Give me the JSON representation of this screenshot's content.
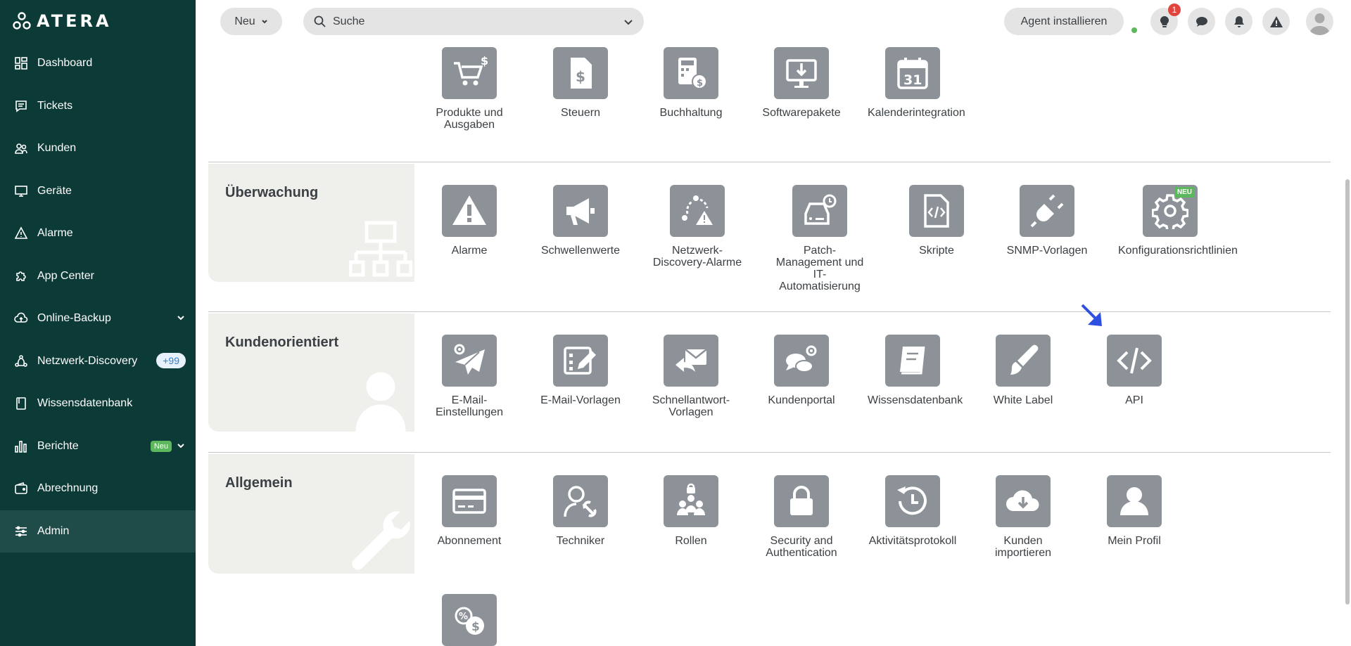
{
  "sidebar": {
    "logo": "ATERA",
    "items": [
      {
        "label": "Dashboard",
        "icon": "dashboard-icon"
      },
      {
        "label": "Tickets",
        "icon": "tickets-icon"
      },
      {
        "label": "Kunden",
        "icon": "customers-icon"
      },
      {
        "label": "Geräte",
        "icon": "devices-icon"
      },
      {
        "label": "Alarme",
        "icon": "alert-icon"
      },
      {
        "label": "App Center",
        "icon": "puzzle-icon"
      },
      {
        "label": "Online-Backup",
        "icon": "cloud-icon"
      },
      {
        "label": "Netzwerk-Discovery",
        "icon": "network-icon",
        "badge": "+99"
      },
      {
        "label": "Wissensdatenbank",
        "icon": "book-icon"
      },
      {
        "label": "Berichte",
        "icon": "chart-icon",
        "tag": "Neu"
      },
      {
        "label": "Abrechnung",
        "icon": "wallet-icon"
      },
      {
        "label": "Admin",
        "icon": "sliders-icon",
        "active": true
      }
    ]
  },
  "topbar": {
    "new_label": "Neu",
    "search_placeholder": "Suche",
    "agent_label": "Agent installieren",
    "notification_count": "1"
  },
  "top_row": [
    {
      "label": "Produkte und Ausgaben",
      "icon": "cart-dollar-icon"
    },
    {
      "label": "Steuern",
      "icon": "tax-document-icon"
    },
    {
      "label": "Buchhaltung",
      "icon": "calculator-icon"
    },
    {
      "label": "Softwarepakete",
      "icon": "download-monitor-icon"
    },
    {
      "label": "Kalenderintegration",
      "icon": "calendar-icon",
      "calendar_day": "31"
    }
  ],
  "sections": {
    "monitoring": {
      "title": "Überwachung",
      "tiles": [
        {
          "label": "Alarme",
          "icon": "warning-icon"
        },
        {
          "label": "Schwellenwerte",
          "icon": "megaphone-icon"
        },
        {
          "label": "Netzwerk-Discovery-Alarme",
          "icon": "network-alert-icon"
        },
        {
          "label": "Patch-Management und IT-Automatisierung",
          "icon": "drive-clock-icon"
        },
        {
          "label": "Skripte",
          "icon": "script-icon"
        },
        {
          "label": "SNMP-Vorlagen",
          "icon": "plug-icon"
        },
        {
          "label": "Konfigurationsrichtlinien",
          "icon": "gear-icon",
          "tag": "NEU"
        }
      ]
    },
    "customer": {
      "title": "Kundenorientiert",
      "tiles": [
        {
          "label": "E-Mail-Einstellungen",
          "icon": "paper-plane-gear-icon"
        },
        {
          "label": "E-Mail-Vorlagen",
          "icon": "template-edit-icon"
        },
        {
          "label": "Schnellantwort-Vorlagen",
          "icon": "reply-mail-icon"
        },
        {
          "label": "Kundenportal",
          "icon": "chat-gear-icon"
        },
        {
          "label": "Wissensdatenbank",
          "icon": "book-icon"
        },
        {
          "label": "White Label",
          "icon": "brush-icon"
        },
        {
          "label": "API",
          "icon": "code-icon"
        }
      ]
    },
    "general": {
      "title": "Allgemein",
      "tiles": [
        {
          "label": "Abonnement",
          "icon": "credit-card-icon"
        },
        {
          "label": "Techniker",
          "icon": "technician-icon"
        },
        {
          "label": "Rollen",
          "icon": "roles-icon"
        },
        {
          "label": "Security and Authentication",
          "icon": "lock-icon"
        },
        {
          "label": "Aktivitätsprotokoll",
          "icon": "history-icon"
        },
        {
          "label": "Kunden importieren",
          "icon": "cloud-download-icon"
        },
        {
          "label": "Mein Profil",
          "icon": "profile-icon"
        }
      ]
    }
  },
  "bottom_row": [
    {
      "label": "",
      "icon": "percent-dollar-icon"
    }
  ],
  "colors": {
    "sidebar_bg": "#0c3a37",
    "tile_bg": "#8c9297",
    "new_tag": "#5cb85c",
    "badge_red": "#e0463e",
    "pointer_blue": "#2f4fe0"
  }
}
